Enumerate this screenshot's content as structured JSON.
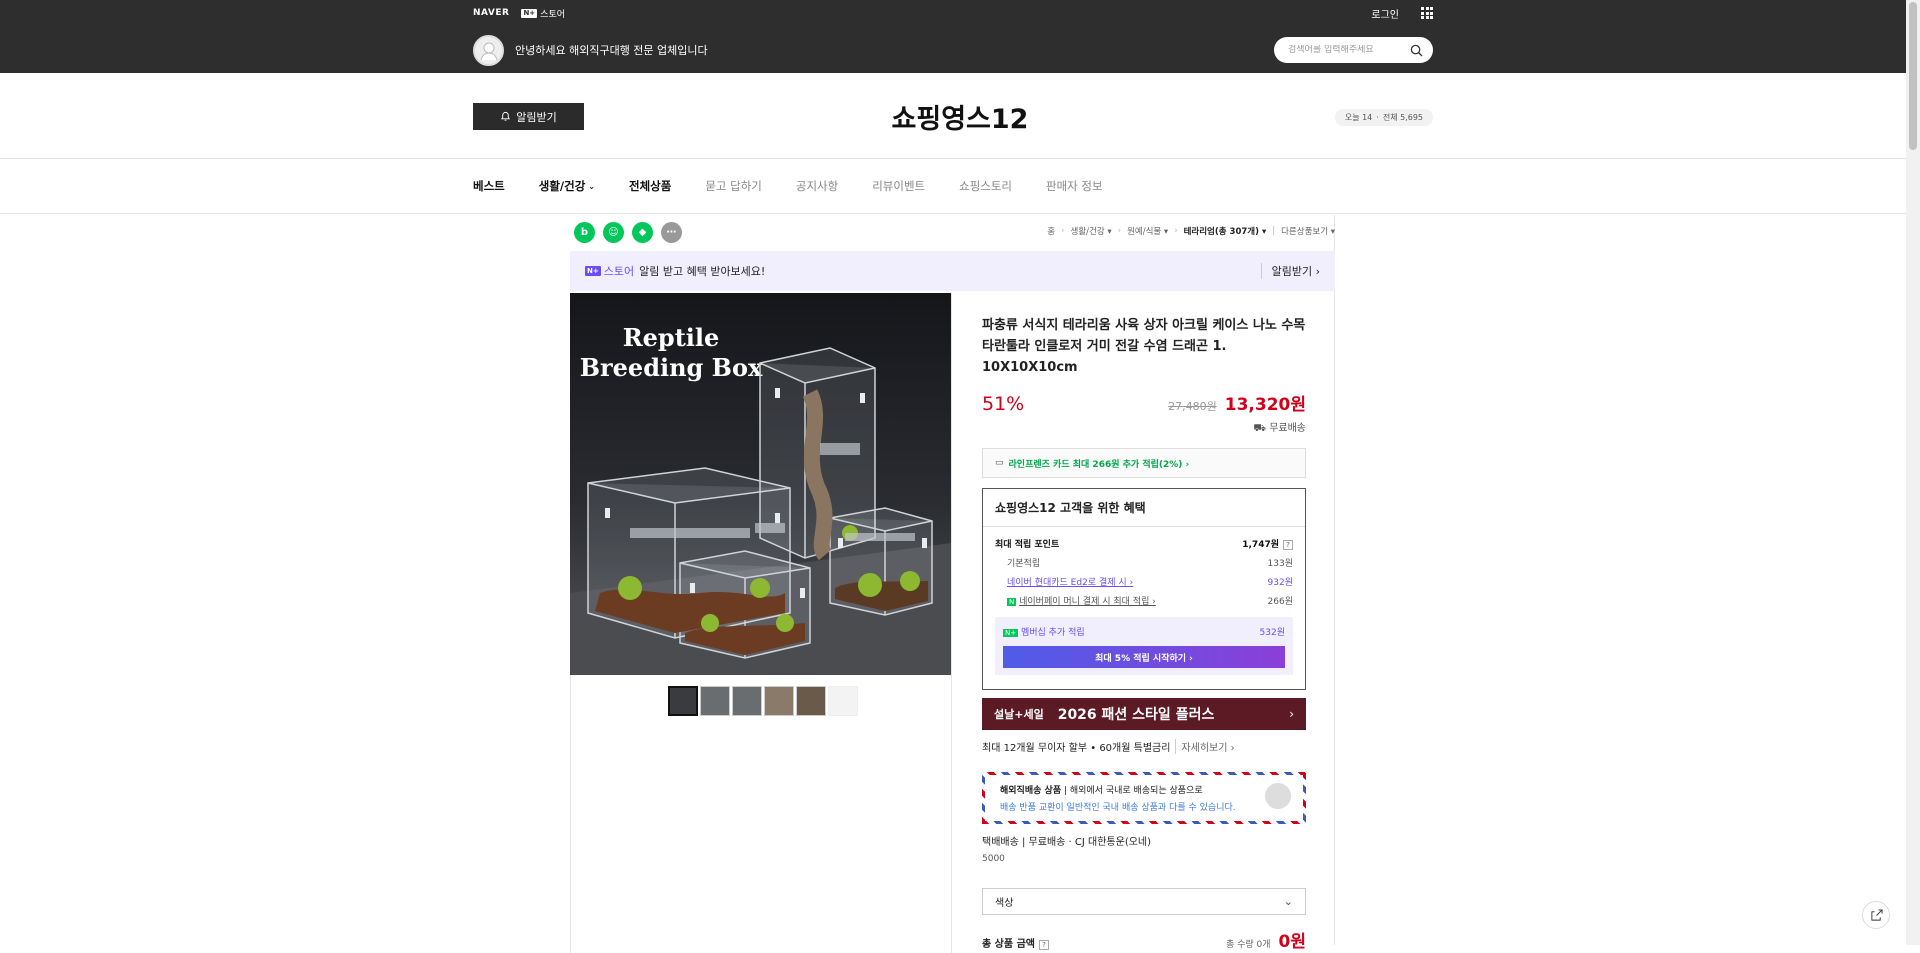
{
  "topbar": {
    "naver": "NAVER",
    "store_badge": "N+",
    "store": "스토어",
    "login": "로그인",
    "greeting": "안녕하세요 해외직구대행 전문 업체입니다",
    "search_placeholder": "검색어를 입력해주세요"
  },
  "brand": {
    "alarm_label": "알림받기",
    "store_name": "쇼핑영스12",
    "visitors_today": "오늘 14",
    "visitors_total": "전체 5,695"
  },
  "nav": {
    "items": [
      {
        "label": "베스트"
      },
      {
        "label": "생활/건강"
      },
      {
        "label": "전체상품"
      },
      {
        "label": "묻고 답하기"
      },
      {
        "label": "공지사항"
      },
      {
        "label": "리뷰이벤트"
      },
      {
        "label": "쇼핑스토리"
      },
      {
        "label": "판매자 정보"
      }
    ]
  },
  "breadcrumb": {
    "home": "홈",
    "c1": "생활/건강",
    "c2": "원예/식물",
    "current": "테라리엄(총 307개)",
    "other": "다른상품보기"
  },
  "notice": {
    "badge": "N+",
    "store": "스토어",
    "text": "알림 받고 혜택 받아보세요!",
    "cta": "알림받기 ›"
  },
  "image": {
    "title_line1": "Reptile",
    "title_line2": "Breeding Box"
  },
  "product": {
    "title": "파충류 서식지 테라리움 사육 상자 아크릴 케이스 나노 수목 타란툴라 인클로저 거미 전갈 수염 드래곤 1. 10X10X10cm",
    "discount": "51%",
    "original_price": "27,480원",
    "price": "13,320원",
    "delivery": "무료배송"
  },
  "card_benefit": "라인프렌즈 카드 최대 266원 추가 적립(2%) ›",
  "benefit": {
    "title": "쇼핑영스12 고객을 위한 혜택",
    "max_points_label": "최대 적립 포인트",
    "max_points_value": "1,747원",
    "basic_label": "기본적립",
    "basic_value": "133원",
    "card_label": "네이버 현대카드 Ed2로 결제 시 ›",
    "card_value": "932원",
    "pay_label": "네이버페이 머니 결제 시 최대 적립 ›",
    "pay_value": "266원",
    "member_label": "멤버십 추가 적립",
    "member_value": "532원",
    "member_btn": "최대 5% 적립 시작하기 ›"
  },
  "event": {
    "t1": "설날+세일",
    "t2": "2026 패션 스타일 플러스",
    "arrow": "›"
  },
  "installment": {
    "text": "최대 12개월 무이자 할부 • 60개월 특별금리",
    "more": "자세히보기 ›"
  },
  "overseas": {
    "label": "해외직배송 상품",
    "desc": "해외에서 국내로 배송되는 상품으로",
    "line2": "배송 반품 교환이 일반적인 국내 배송 상품과 다를 수 있습니다."
  },
  "shipping": {
    "method": "택배배송",
    "fee": "무료배송",
    "carrier": "CJ 대한통운(오네)",
    "code": "5000"
  },
  "option": {
    "label": "색상",
    "chevron": "⌄"
  },
  "total": {
    "label": "총 상품 금액",
    "q": "?",
    "count": "총 수량 0개",
    "amount": "0원"
  },
  "colors": {
    "accent": "#6b4cf6",
    "price": "#d0021b",
    "green": "#03c75a"
  }
}
